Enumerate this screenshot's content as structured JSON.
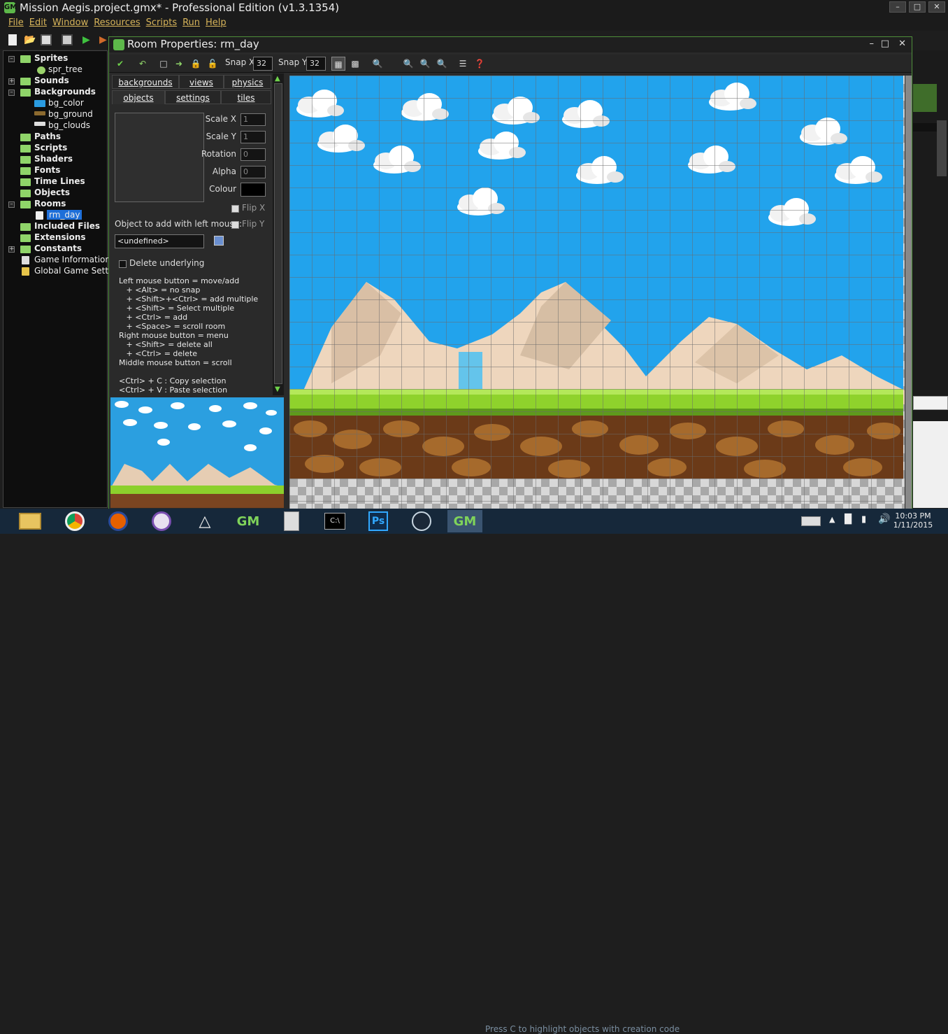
{
  "window": {
    "title": "Mission Aegis.project.gmx*  -  Professional Edition (v1.3.1354)",
    "logo_text": "GM"
  },
  "menu": [
    "File",
    "Edit",
    "Window",
    "Resources",
    "Scripts",
    "Run",
    "Help"
  ],
  "tree": {
    "sprites": "Sprites",
    "spr_tree": "spr_tree",
    "sounds": "Sounds",
    "backgrounds": "Backgrounds",
    "bg_color": "bg_color",
    "bg_ground": "bg_ground",
    "bg_clouds": "bg_clouds",
    "paths": "Paths",
    "scripts": "Scripts",
    "shaders": "Shaders",
    "fonts": "Fonts",
    "timelines": "Time Lines",
    "objects": "Objects",
    "rooms": "Rooms",
    "rm_day": "rm_day",
    "included": "Included Files",
    "extensions": "Extensions",
    "constants": "Constants",
    "gameinfo": "Game Information",
    "globalsettings": "Global Game Settings"
  },
  "room": {
    "title": "Room Properties: rm_day",
    "snap_x_label": "Snap X:",
    "snap_x": "32",
    "snap_y_label": "Snap Y:",
    "snap_y": "32"
  },
  "tabs": {
    "backgrounds": "backgrounds",
    "views": "views",
    "physics": "physics",
    "objects": "objects",
    "settings": "settings",
    "tiles": "tiles"
  },
  "props": {
    "scale_x_label": "Scale X",
    "scale_x": "1",
    "scale_y_label": "Scale Y",
    "scale_y": "1",
    "rotation_label": "Rotation",
    "rotation": "0",
    "alpha_label": "Alpha",
    "alpha": "0",
    "colour_label": "Colour",
    "flip_x": "Flip X",
    "flip_y": "Flip Y",
    "object_label": "Object to add with left mouse:",
    "object_value": "<undefined>",
    "delete_underlying": "Delete underlying"
  },
  "help": [
    "Left mouse button = move/add",
    "   + <Alt> = no snap",
    "   + <Shift>+<Ctrl> = add multiple",
    "   + <Shift> = Select multiple",
    "   + <Ctrl> = add",
    "   + <Space> = scroll room",
    "Right mouse button = menu",
    "   + <Shift> = delete all",
    "   + <Ctrl> = delete",
    "Middle mouse button = scroll",
    "",
    "<Ctrl> + C : Copy selection",
    "<Ctrl> + V : Paste selection"
  ],
  "taskbar": {
    "status": "Press C to highlight objects with creation code",
    "time": "10:03 PM",
    "date": "1/11/2015"
  },
  "colors": {
    "sky": "#23a4ea",
    "grass": "#8cd02c",
    "dirt": "#6b3a18",
    "accent": "#4e8f3a"
  }
}
